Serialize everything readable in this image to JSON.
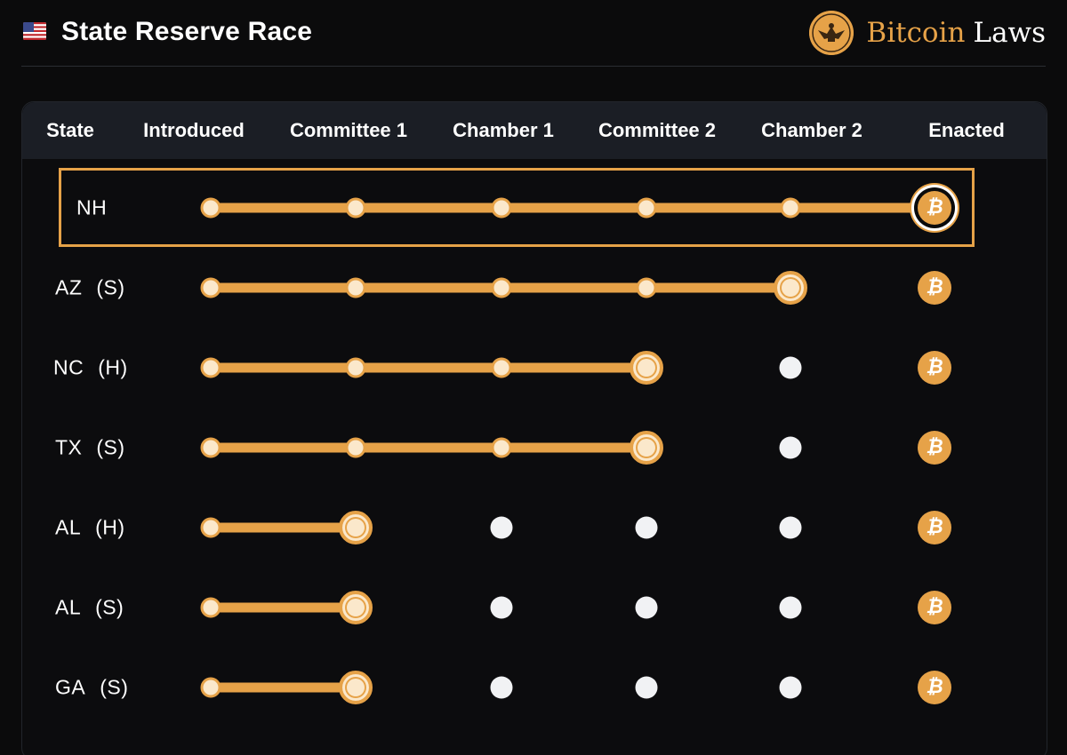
{
  "header": {
    "flag_icon": "us-flag-icon",
    "title": "State Reserve Race",
    "brand": {
      "logo_icon": "eagle-seal-icon",
      "name_part1": "Bitcoin",
      "name_part2": "Laws"
    }
  },
  "columns": [
    "State",
    "Introduced",
    "Committee 1",
    "Chamber 1",
    "Committee 2",
    "Chamber 2",
    "Enacted"
  ],
  "stages_total": 6,
  "rows": [
    {
      "state": "NH",
      "chamber": "",
      "stages_completed": 6,
      "highlighted": true
    },
    {
      "state": "AZ",
      "chamber": "(S)",
      "stages_completed": 5,
      "highlighted": false
    },
    {
      "state": "NC",
      "chamber": "(H)",
      "stages_completed": 4,
      "highlighted": false
    },
    {
      "state": "TX",
      "chamber": "(S)",
      "stages_completed": 4,
      "highlighted": false
    },
    {
      "state": "AL",
      "chamber": "(H)",
      "stages_completed": 2,
      "highlighted": false
    },
    {
      "state": "AL",
      "chamber": "(S)",
      "stages_completed": 2,
      "highlighted": false
    },
    {
      "state": "GA",
      "chamber": "(S)",
      "stages_completed": 2,
      "highlighted": false
    }
  ],
  "enacted_icon": "bitcoin-icon",
  "enacted_symbol": "₿",
  "colors": {
    "accent": "#e6a248",
    "background": "#0b0b0c",
    "header_bar": "#1b1e25",
    "pending_dot": "#f1f2f4"
  }
}
